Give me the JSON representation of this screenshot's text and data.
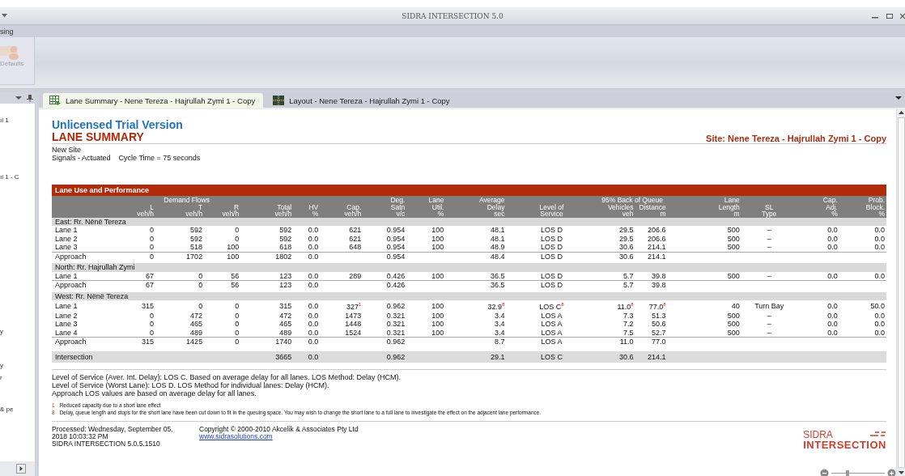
{
  "window": {
    "title": "SIDRA INTERSECTION 5.0"
  },
  "menu": {
    "label": "sing"
  },
  "ribbon": {
    "buttons": [
      {
        "label": "Defaults",
        "disabled": true
      }
    ]
  },
  "side_panel": {
    "items": [
      "ıi 1",
      "ıi 1 - C",
      "y",
      "y",
      "r",
      "& pe"
    ]
  },
  "tabs": [
    {
      "label": "Lane Summary - Nene Tereza - Hajrullah Zymi 1 - Copy",
      "selected": true,
      "kind": "table"
    },
    {
      "label": "Layout - Nene Tereza - Hajrullah Zymi 1 - Copy",
      "selected": false,
      "kind": "layout"
    }
  ],
  "report": {
    "banner": "Unlicensed Trial Version",
    "title": "LANE SUMMARY",
    "site": "Site: Nene Tereza - Hajrullah Zymi 1 - Copy",
    "info": [
      "New Site",
      "Signals - Actuated",
      "Cycle Time = 75 seconds"
    ],
    "table": {
      "title": "Lane Use and Performance",
      "columns": [
        {
          "label": "Demand Flows",
          "children": [
            {
              "lines": [
                "L",
                "veh/h"
              ]
            },
            {
              "lines": [
                "T",
                "veh/h"
              ]
            },
            {
              "lines": [
                "R",
                "veh/h"
              ]
            }
          ]
        },
        {
          "lines": [
            "Total",
            "veh/h"
          ]
        },
        {
          "lines": [
            "HV",
            "%"
          ]
        },
        {
          "lines": [
            "Cap.",
            "veh/h"
          ]
        },
        {
          "lines": [
            "Deg.",
            "Satn",
            "v/c"
          ]
        },
        {
          "lines": [
            "Lane",
            "Util.",
            "%"
          ]
        },
        {
          "lines": [
            "Average",
            "Delay",
            "sec"
          ]
        },
        {
          "lines": [
            "Level of",
            "Service"
          ]
        },
        {
          "label": "95% Back of Queue",
          "children": [
            {
              "lines": [
                "Vehicles",
                "veh"
              ]
            },
            {
              "lines": [
                "Distance",
                "m"
              ]
            }
          ]
        },
        {
          "lines": [
            "Lane",
            "Length",
            "m"
          ]
        },
        {
          "lines": [
            "SL",
            "Type"
          ]
        },
        {
          "lines": [
            "Cap.",
            "Adj.",
            "%"
          ]
        },
        {
          "lines": [
            "Prob.",
            "Block.",
            "%"
          ]
        }
      ],
      "sections": [
        {
          "title": "East: Rr. Nënë Tereza",
          "rows": [
            {
              "kind": "lane",
              "cells": [
                "Lane 1",
                "0",
                "592",
                "0",
                "592",
                "0.0",
                "621",
                "0.954",
                "100",
                "48.1",
                "LOS D",
                "29.5",
                "206.6",
                "500",
                "–",
                "0.0",
                "0.0"
              ]
            },
            {
              "kind": "lane",
              "cells": [
                "Lane 2",
                "0",
                "592",
                "0",
                "592",
                "0.0",
                "621",
                "0.954",
                "100",
                "48.1",
                "LOS D",
                "29.5",
                "206.6",
                "500",
                "–",
                "0.0",
                "0.0"
              ]
            },
            {
              "kind": "lane",
              "cells": [
                "Lane 3",
                "0",
                "518",
                "100",
                "618",
                "0.0",
                "648",
                "0.954",
                "100",
                "48.9",
                "LOS D",
                "30.6",
                "214.1",
                "500",
                "–",
                "0.0",
                "0.0"
              ]
            },
            {
              "kind": "approach",
              "cells": [
                "Approach",
                "0",
                "1702",
                "100",
                "1802",
                "0.0",
                null,
                "0.954",
                null,
                "48.4",
                "LOS D",
                "30.6",
                "214.1",
                null,
                null,
                null,
                null
              ]
            }
          ]
        },
        {
          "title": "North: Rr. Hajrullah Zymi",
          "rows": [
            {
              "kind": "lane",
              "cells": [
                "Lane 1",
                "67",
                "0",
                "56",
                "123",
                "0.0",
                "289",
                "0.426",
                "100",
                "36.5",
                "LOS D",
                "5.7",
                "39.8",
                "500",
                "–",
                "0.0",
                "0.0"
              ]
            },
            {
              "kind": "approach",
              "cells": [
                "Approach",
                "67",
                "0",
                "56",
                "123",
                "0.0",
                null,
                "0.426",
                null,
                "36.5",
                "LOS D",
                "5.7",
                "39.8",
                null,
                null,
                null,
                null
              ]
            }
          ]
        },
        {
          "title": "West: Rr. Nënë Tereza",
          "rows": [
            {
              "kind": "lane",
              "cells": [
                "Lane 1",
                "315",
                "0",
                "0",
                "315",
                "0.0",
                "327$^{1}$",
                "0.962",
                "100",
                "32.9$^{8}$",
                "LOS C$^{8}$",
                "11.0$^{8}$",
                "77.0$^{8}$",
                "40",
                "Turn Bay",
                "0.0",
                "50.0"
              ]
            },
            {
              "kind": "lane",
              "cells": [
                "Lane 2",
                "0",
                "472",
                "0",
                "472",
                "0.0",
                "1473",
                "0.321",
                "100",
                "3.4",
                "LOS A",
                "7.3",
                "51.3",
                "500",
                "–",
                "0.0",
                "0.0"
              ]
            },
            {
              "kind": "lane",
              "cells": [
                "Lane 3",
                "0",
                "465",
                "0",
                "465",
                "0.0",
                "1448",
                "0.321",
                "100",
                "3.4",
                "LOS A",
                "7.2",
                "50.6",
                "500",
                "–",
                "0.0",
                "0.0"
              ]
            },
            {
              "kind": "lane",
              "cells": [
                "Lane 4",
                "0",
                "489",
                "0",
                "489",
                "0.0",
                "1524",
                "0.321",
                "100",
                "3.4",
                "LOS A",
                "7.5",
                "52.7",
                "500",
                "–",
                "0.0",
                "0.0"
              ]
            },
            {
              "kind": "approach",
              "cells": [
                "Approach",
                "315",
                "1425",
                "0",
                "1740",
                "0.0",
                null,
                "0.962",
                null,
                "8.7",
                "LOS A",
                "11.0",
                "77.0",
                null,
                null,
                null,
                null
              ]
            }
          ]
        },
        {
          "rows": [
            {
              "kind": "intersection",
              "cells": [
                "Intersection",
                null,
                null,
                null,
                "3665",
                "0.0",
                null,
                "0.962",
                null,
                "29.1",
                "LOS C",
                "30.6",
                "214.1",
                null,
                null,
                null,
                null
              ]
            }
          ]
        }
      ]
    },
    "notes": [
      "Level of Service (Aver. Int. Delay): LOS C.  Based on average delay for all lanes.  LOS Method: Delay (HCM).",
      "Level of Service (Worst Lane): LOS D.  LOS Method for individual lanes: Delay (HCM).",
      "Approach LOS values are based on average delay for all lanes."
    ],
    "footnotes": [
      {
        "mark": "1",
        "text": "Reduced capacity due to a short lane effect"
      },
      {
        "mark": "8",
        "text": "Delay, queue length and stops for the short lane have been cut down to fit in the queuing space. You may wish to change the short lane to a full lane to investigate the effect on the adjacent lane performance."
      }
    ],
    "processed": "Processed: Wednesday, September 05, 2018 10:03:32 PM",
    "version": "SIDRA INTERSECTION 5.0.5.1510",
    "copyright": "Copyright © 2000-2010 Akcelik & Associates Pty Ltd",
    "link": "www.sidrasolutions.com",
    "logo": [
      "SIDRA",
      "INTERSECTION"
    ]
  },
  "zoom": {
    "level": 0.3
  }
}
